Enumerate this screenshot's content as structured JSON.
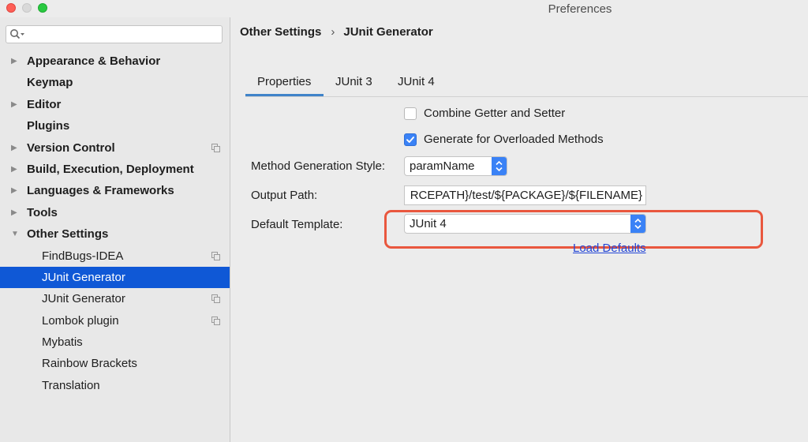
{
  "window": {
    "title": "Preferences"
  },
  "sidebar": {
    "search": {
      "value": "",
      "placeholder": ""
    },
    "items": [
      {
        "label": "Appearance & Behavior",
        "expandable": true
      },
      {
        "label": "Keymap"
      },
      {
        "label": "Editor",
        "expandable": true
      },
      {
        "label": "Plugins"
      },
      {
        "label": "Version Control",
        "expandable": true,
        "copy_icon": true
      },
      {
        "label": "Build, Execution, Deployment",
        "expandable": true
      },
      {
        "label": "Languages & Frameworks",
        "expandable": true
      },
      {
        "label": "Tools",
        "expandable": true
      },
      {
        "label": "Other Settings",
        "expanded": true
      },
      {
        "label": "FindBugs-IDEA",
        "child": true,
        "copy_icon": true
      },
      {
        "label": "JUnit Generator",
        "child": true,
        "selected": true
      },
      {
        "label": "JUnit Generator",
        "child": true,
        "copy_icon": true
      },
      {
        "label": "Lombok plugin",
        "child": true,
        "copy_icon": true
      },
      {
        "label": "Mybatis",
        "child": true
      },
      {
        "label": "Rainbow Brackets",
        "child": true
      },
      {
        "label": "Translation",
        "child": true
      }
    ]
  },
  "breadcrumb": {
    "parent": "Other Settings",
    "separator": "›",
    "current": "JUnit Generator"
  },
  "tabs": [
    {
      "label": "Properties",
      "active": true
    },
    {
      "label": "JUnit 3"
    },
    {
      "label": "JUnit 4"
    }
  ],
  "properties": {
    "combine_getter_setter": {
      "label": "Combine Getter and Setter",
      "checked": false
    },
    "generate_overloaded": {
      "label": "Generate for Overloaded Methods",
      "checked": true
    },
    "method_generation_style": {
      "label": "Method Generation Style:",
      "value": "paramName"
    },
    "output_path": {
      "label": "Output Path:",
      "value": "RCEPATH}/test/${PACKAGE}/${FILENAME}"
    },
    "default_template": {
      "label": "Default Template:",
      "value": "JUnit 4"
    },
    "load_defaults": "Load Defaults"
  },
  "colors": {
    "selection": "#0f58d6",
    "accent": "#3a82f6",
    "highlight_box": "#e9573e",
    "link": "#2446d6"
  }
}
